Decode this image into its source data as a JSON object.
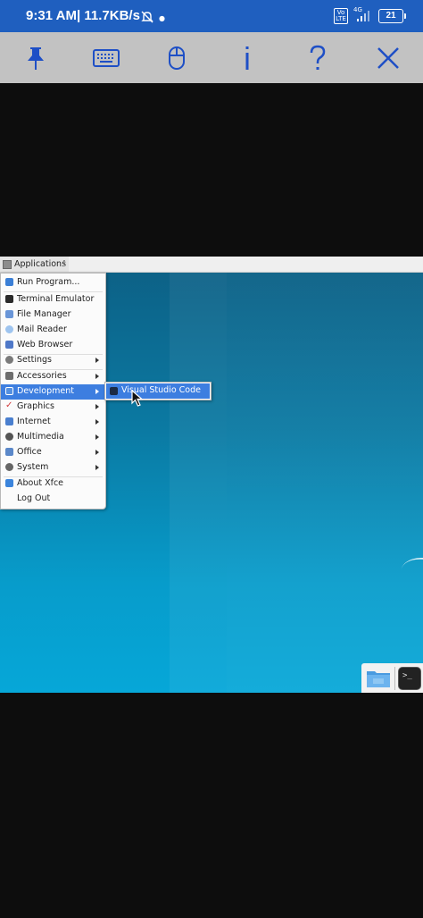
{
  "status_bar": {
    "time": "9:31 AM",
    "network_speed": "| 11.7KB/s",
    "volte": "Vo LTE",
    "signal_type": "4G",
    "battery": "21"
  },
  "vnc_toolbar": {
    "buttons": [
      "pin-icon",
      "keyboard-icon",
      "mouse-icon",
      "info-icon",
      "help-icon",
      "close-icon"
    ],
    "accent_color": "#1e4fc6"
  },
  "panel": {
    "applications_label": "Applications"
  },
  "menu": {
    "items": [
      {
        "label": "Run Program...",
        "icon": "run-program-icon",
        "color": "#3b7fd6"
      },
      {
        "label": "Terminal Emulator",
        "icon": "terminal-icon",
        "color": "#2a2a2a"
      },
      {
        "label": "File Manager",
        "icon": "file-manager-icon",
        "color": "#6a96d8"
      },
      {
        "label": "Mail Reader",
        "icon": "mail-icon",
        "color": "#9ec4ef"
      },
      {
        "label": "Web Browser",
        "icon": "globe-icon",
        "color": "#4f78c8"
      },
      {
        "label": "Settings",
        "icon": "settings-icon",
        "color": "#7a7a7a"
      },
      {
        "label": "Accessories",
        "icon": "accessories-icon",
        "color": "#6e6e6e"
      },
      {
        "label": "Development",
        "icon": "development-icon",
        "color": "#5590e0"
      },
      {
        "label": "Graphics",
        "icon": "graphics-icon",
        "color": "#d23c3c"
      },
      {
        "label": "Internet",
        "icon": "internet-icon",
        "color": "#4a7fcf"
      },
      {
        "label": "Multimedia",
        "icon": "multimedia-icon",
        "color": "#555555"
      },
      {
        "label": "Office",
        "icon": "office-icon",
        "color": "#5b88c9"
      },
      {
        "label": "System",
        "icon": "system-icon",
        "color": "#666666"
      },
      {
        "label": "About Xfce",
        "icon": "about-icon",
        "color": "#3b84dc"
      },
      {
        "label": "Log Out",
        "icon": "",
        "color": ""
      }
    ],
    "selected": "Development"
  },
  "submenu": {
    "items": [
      {
        "label": "Visual Studio Code",
        "icon": "vscode-icon"
      }
    ]
  },
  "dock": {
    "items": [
      "folder-icon",
      "terminal-icon"
    ],
    "terminal_glyph": ">_"
  }
}
